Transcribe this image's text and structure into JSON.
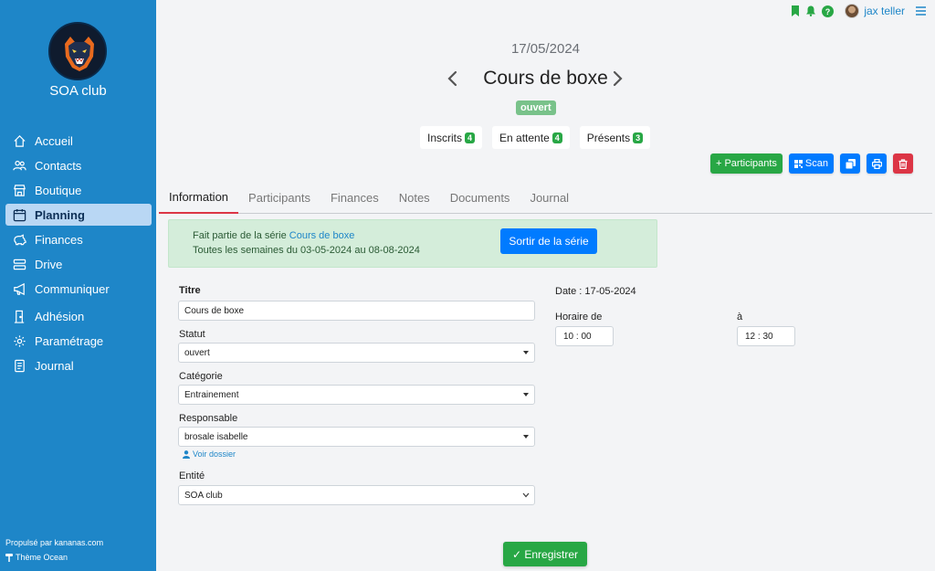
{
  "sidebar": {
    "club_name": "SOA club",
    "items": [
      {
        "label": "Accueil",
        "icon": "home-icon"
      },
      {
        "label": "Contacts",
        "icon": "users-icon"
      },
      {
        "label": "Boutique",
        "icon": "store-icon"
      },
      {
        "label": "Planning",
        "icon": "calendar-icon",
        "active": true
      },
      {
        "label": "Finances",
        "icon": "piggy-bank-icon"
      },
      {
        "label": "Drive",
        "icon": "drive-icon"
      },
      {
        "label": "Communiquer",
        "icon": "megaphone-icon"
      },
      {
        "label": "Adhésion",
        "icon": "door-icon"
      },
      {
        "label": "Paramétrage",
        "icon": "gear-icon"
      },
      {
        "label": "Journal",
        "icon": "journal-icon"
      }
    ],
    "footer_powered": "Propulsé par kananas.com",
    "footer_theme": "Thème Ocean"
  },
  "topbar": {
    "user_name": "jax teller"
  },
  "header": {
    "date": "17/05/2024",
    "title": "Cours de boxe",
    "status": "ouvert"
  },
  "counts": [
    {
      "label": "Inscrits",
      "value": "4"
    },
    {
      "label": "En attente",
      "value": "4"
    },
    {
      "label": "Présents",
      "value": "3"
    }
  ],
  "actions": {
    "participants": "+ Participants",
    "scan": "Scan"
  },
  "tabs": [
    "Information",
    "Participants",
    "Finances",
    "Notes",
    "Documents",
    "Journal"
  ],
  "series": {
    "prefix": "Fait partie de la série ",
    "link": "Cours de boxe",
    "schedule": "Toutes les semaines du 03-05-2024 au 08-08-2024",
    "leave_button": "Sortir de la série"
  },
  "form": {
    "titre_label": "Titre",
    "titre_value": "Cours de boxe",
    "statut_label": "Statut",
    "statut_value": "ouvert",
    "categorie_label": "Catégorie",
    "categorie_value": "Entrainement",
    "responsable_label": "Responsable",
    "responsable_value": "brosale isabelle",
    "voir_dossier": "Voir dossier",
    "entite_label": "Entité",
    "entite_value": "SOA club",
    "date_text": "Date : 17-05-2024",
    "horaire_label": "Horaire de",
    "a_label": "à",
    "start_time": "10 : 00",
    "end_time": "12 : 30",
    "save_button": "✓ Enregistrer"
  },
  "colors": {
    "sidebar": "#1e86c8",
    "primary": "#007bff",
    "success": "#28a745",
    "danger": "#dc3545"
  }
}
